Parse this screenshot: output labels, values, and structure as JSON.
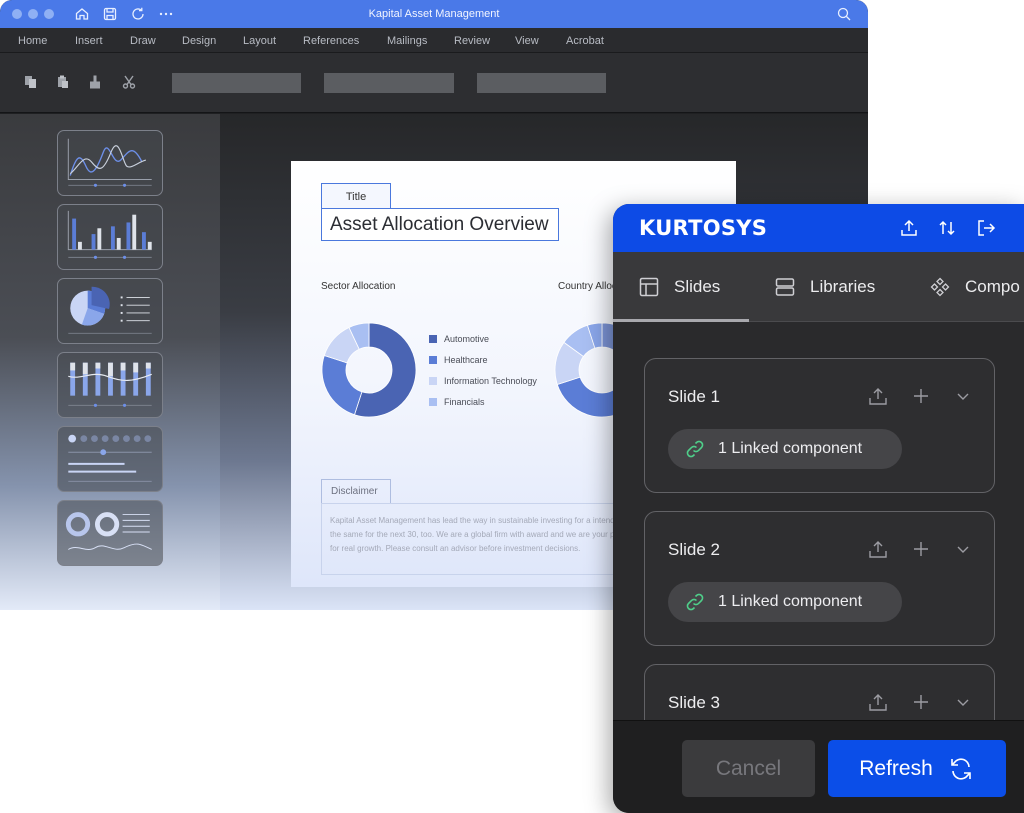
{
  "window": {
    "title": "Kapital Asset Management",
    "accent": "#4a79e8"
  },
  "menu": {
    "items": [
      "Home",
      "Insert",
      "Draw",
      "Design",
      "Layout",
      "References",
      "Mailings",
      "Review",
      "View",
      "Acrobat"
    ]
  },
  "slide": {
    "title_tab": "Title",
    "title": "Asset Allocation Overview",
    "sector_title": "Sector Allocation",
    "country_title": "Country Allocation",
    "legend": [
      "Automotive",
      "Healthcare",
      "Information Technology",
      "Financials"
    ],
    "legend_colors": [
      "#4a64b3",
      "#5b7dd6",
      "#c9d5f5",
      "#a9bff2"
    ],
    "disclaimer_tab": "Disclaimer",
    "disclaimer_text": "Kapital Asset Management has lead the way in sustainable investing for a intend to do the same for the next 30, too. We are a global firm with award and we are your partner for real growth. Please consult an advisor before investment decisions."
  },
  "chart_data": [
    {
      "type": "pie",
      "title": "Sector Allocation",
      "categories": [
        "Automotive",
        "Healthcare",
        "Information Technology",
        "Financials"
      ],
      "values": [
        55,
        25,
        13,
        7
      ]
    },
    {
      "type": "pie",
      "title": "Country Allocation",
      "categories": [],
      "values": [
        40,
        30,
        15,
        10,
        5
      ]
    }
  ],
  "panel": {
    "logo": "KURTOSYS",
    "brand_color": "#0d4be6",
    "tabs": [
      {
        "label": "Slides",
        "icon": "layout-icon"
      },
      {
        "label": "Libraries",
        "icon": "libraries-icon"
      },
      {
        "label": "Compo",
        "icon": "components-icon"
      }
    ],
    "slides": [
      {
        "title": "Slide 1",
        "linked": "1 Linked component"
      },
      {
        "title": "Slide 2",
        "linked": "1 Linked component"
      },
      {
        "title": "Slide 3",
        "linked": ""
      }
    ],
    "cancel_label": "Cancel",
    "refresh_label": "Refresh"
  }
}
